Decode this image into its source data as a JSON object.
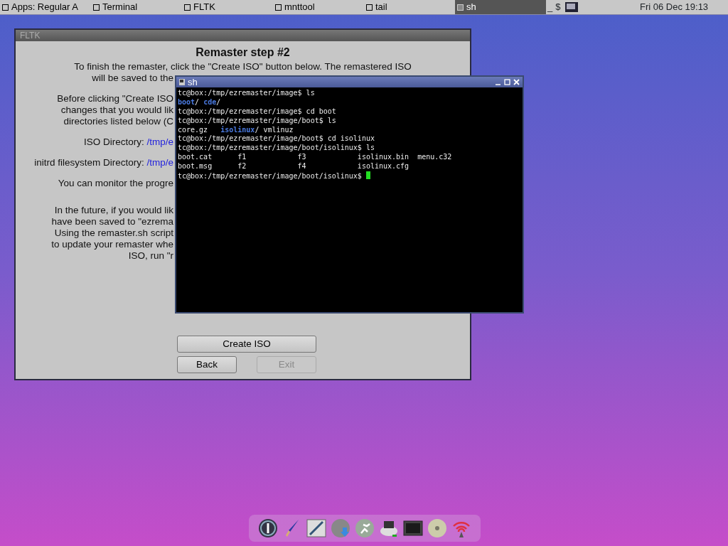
{
  "taskbar": {
    "tasks": [
      {
        "label": "Apps: Regular A",
        "selected": false
      },
      {
        "label": "Terminal",
        "selected": false
      },
      {
        "label": "FLTK",
        "selected": false
      },
      {
        "label": "mnttool",
        "selected": false
      },
      {
        "label": "tail",
        "selected": false
      },
      {
        "label": "sh",
        "selected": true
      }
    ],
    "tray": [
      "_",
      "$"
    ],
    "clock": "Fri 06 Dec 19:13"
  },
  "fltk_window": {
    "title": "FLTK",
    "heading": "Remaster step #2",
    "intro": "To finish the remaster, click the \"Create ISO\" button below.  The remastered ISO",
    "paragraphs": [
      [
        {
          "text": "will be saved to the"
        }
      ],
      [
        {
          "text": "Before clicking \"Create ISO"
        },
        {
          "text": "changes that you would lik"
        },
        {
          "text": "directories listed below (C"
        }
      ],
      [
        {
          "text": "ISO Directory:",
          "link": "/tmp/e"
        }
      ],
      [
        {
          "text": "initrd filesystem Directory:",
          "link": "/tmp/e"
        }
      ],
      [
        {
          "text": "You can monitor the progre"
        }
      ],
      [
        {
          "text": "In the future, if you would lik"
        },
        {
          "text": "have been saved to \"ezrema"
        },
        {
          "text": "Using the remaster.sh script"
        },
        {
          "text": "to update your remaster whe"
        },
        {
          "text": "ISO, run \"r"
        }
      ]
    ],
    "buttons": [
      {
        "label": "Create ISO",
        "disabled": false
      },
      {
        "label": "Back",
        "disabled": false
      },
      {
        "label": "Exit",
        "disabled": true
      }
    ]
  },
  "terminal": {
    "title": "sh",
    "lines": [
      [
        {
          "text": "tc@box:/tmp/ezremaster/image$ ls",
          "kind": "plain"
        }
      ],
      [
        {
          "text": "boot",
          "kind": "dir"
        },
        {
          "text": "/ ",
          "kind": "plain"
        },
        {
          "text": "cde",
          "kind": "dir"
        },
        {
          "text": "/",
          "kind": "plain"
        }
      ],
      [
        {
          "text": "tc@box:/tmp/ezremaster/image$ cd boot",
          "kind": "plain"
        }
      ],
      [
        {
          "text": "tc@box:/tmp/ezremaster/image/boot$ ls",
          "kind": "plain"
        }
      ],
      [
        {
          "text": "core.gz   ",
          "kind": "plain"
        },
        {
          "text": "isolinux",
          "kind": "dir"
        },
        {
          "text": "/ vmlinuz",
          "kind": "plain"
        }
      ],
      [
        {
          "text": "tc@box:/tmp/ezremaster/image/boot$ cd isolinux",
          "kind": "plain"
        }
      ],
      [
        {
          "text": "tc@box:/tmp/ezremaster/image/boot/isolinux$ ls",
          "kind": "plain"
        }
      ],
      [
        {
          "text": "boot.cat      f1            f3            isolinux.bin  menu.c32",
          "kind": "plain"
        }
      ],
      [
        {
          "text": "boot.msg      f2            f4            isolinux.cfg",
          "kind": "plain"
        }
      ],
      [
        {
          "text": "tc@box:/tmp/ezremaster/image/boot/isolinux$ ",
          "kind": "prompt"
        }
      ]
    ]
  }
}
